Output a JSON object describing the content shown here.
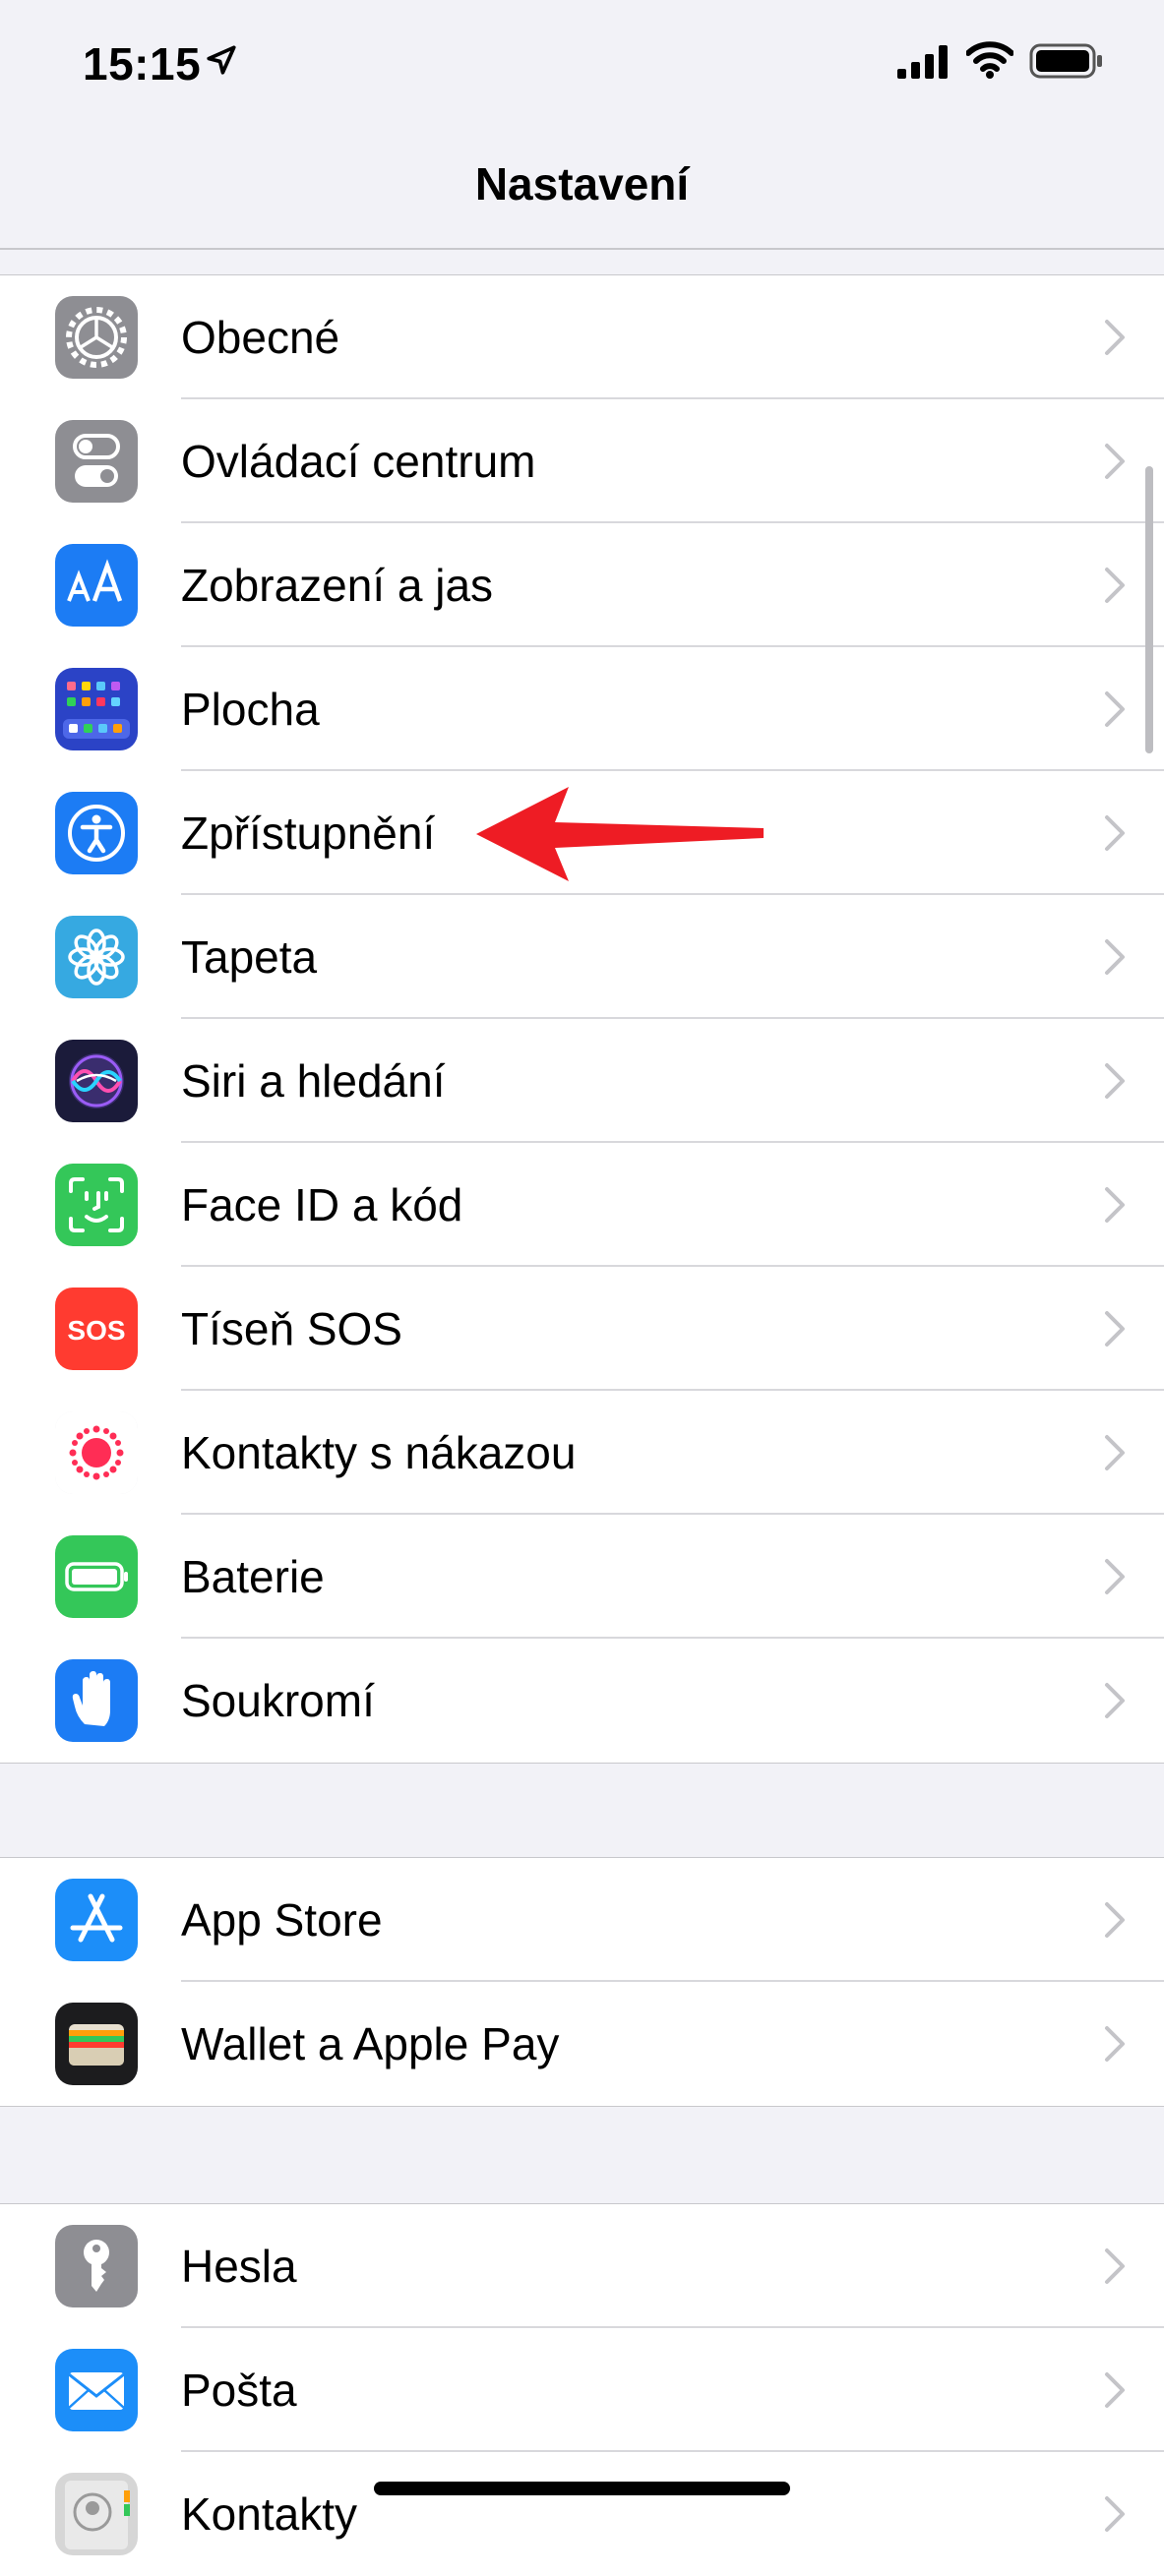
{
  "status_bar": {
    "time": "15:15",
    "icons": [
      "location-arrow-icon",
      "cellular-signal-icon",
      "wifi-icon",
      "battery-icon"
    ]
  },
  "nav": {
    "title": "Nastavení"
  },
  "groups": [
    {
      "items": [
        {
          "label": "Obecné",
          "icon": "gear-icon",
          "color": "#8e8e93"
        },
        {
          "label": "Ovládací centrum",
          "icon": "toggles-icon",
          "color": "#8e8e93"
        },
        {
          "label": "Zobrazení a jas",
          "icon": "text-size-icon",
          "color": "#1c7cf4"
        },
        {
          "label": "Plocha",
          "icon": "home-screen-grid-icon",
          "color": "#2b43c6"
        },
        {
          "label": "Zpřístupnění",
          "icon": "accessibility-icon",
          "color": "#1c7cf4"
        },
        {
          "label": "Tapeta",
          "icon": "flower-icon",
          "color": "#36a9e1"
        },
        {
          "label": "Siri a hledání",
          "icon": "siri-icon",
          "color": "#1b1b3a"
        },
        {
          "label": "Face ID a kód",
          "icon": "face-id-icon",
          "color": "#34c759"
        },
        {
          "label": "Tíseň SOS",
          "icon": "sos-icon",
          "color": "#ff3b30",
          "icon_text": "SOS"
        },
        {
          "label": "Kontakty s nákazou",
          "icon": "exposure-notification-icon",
          "color": "#ffffff"
        },
        {
          "label": "Baterie",
          "icon": "battery-icon",
          "color": "#34c759"
        },
        {
          "label": "Soukromí",
          "icon": "hand-icon",
          "color": "#1c7cf4"
        }
      ]
    },
    {
      "items": [
        {
          "label": "App Store",
          "icon": "app-store-icon",
          "color": "#1c8ef9"
        },
        {
          "label": "Wallet a Apple Pay",
          "icon": "wallet-icon",
          "color": "#1c1c1e"
        }
      ]
    },
    {
      "items": [
        {
          "label": "Hesla",
          "icon": "key-icon",
          "color": "#8e8e93"
        },
        {
          "label": "Pošta",
          "icon": "mail-icon",
          "color": "#1c8ef9"
        },
        {
          "label": "Kontakty",
          "icon": "contacts-icon",
          "color": "#d6d6d6"
        }
      ]
    }
  ],
  "annotation": {
    "icon": "red-arrow-icon",
    "color": "#ee1c24",
    "points_to": "Zpřístupnění"
  },
  "colors": {
    "background": "#f2f2f7",
    "cell": "#ffffff",
    "separator": "#d8d8dc",
    "chevron": "#c4c4c8"
  }
}
